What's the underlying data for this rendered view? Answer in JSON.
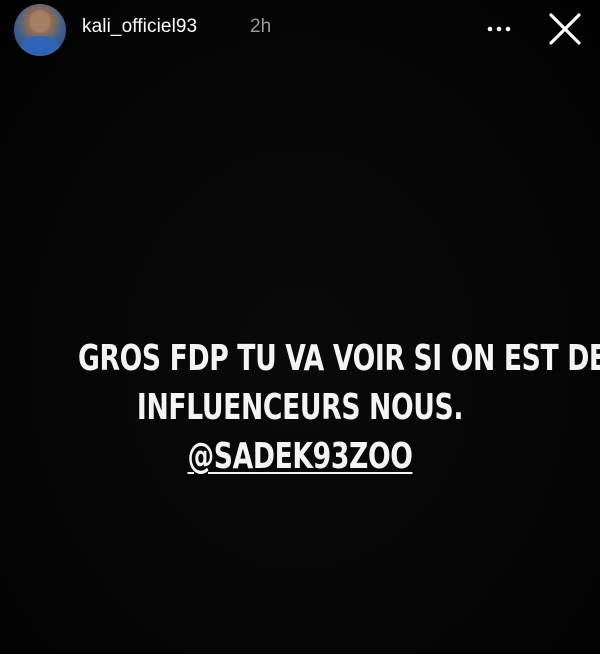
{
  "story": {
    "username": "kali_officiel93",
    "time_ago": "2h",
    "more_icon": "more-horizontal-icon",
    "close_icon": "close-x-icon",
    "background_color": "#050505",
    "text_color": "#f4f4f4",
    "caption": {
      "line1": "GROS FDP TU VA VOIR SI ON EST DES",
      "line2": "INFLUENCEURS NOUS.",
      "mention": "@SADEK93ZOO"
    }
  }
}
